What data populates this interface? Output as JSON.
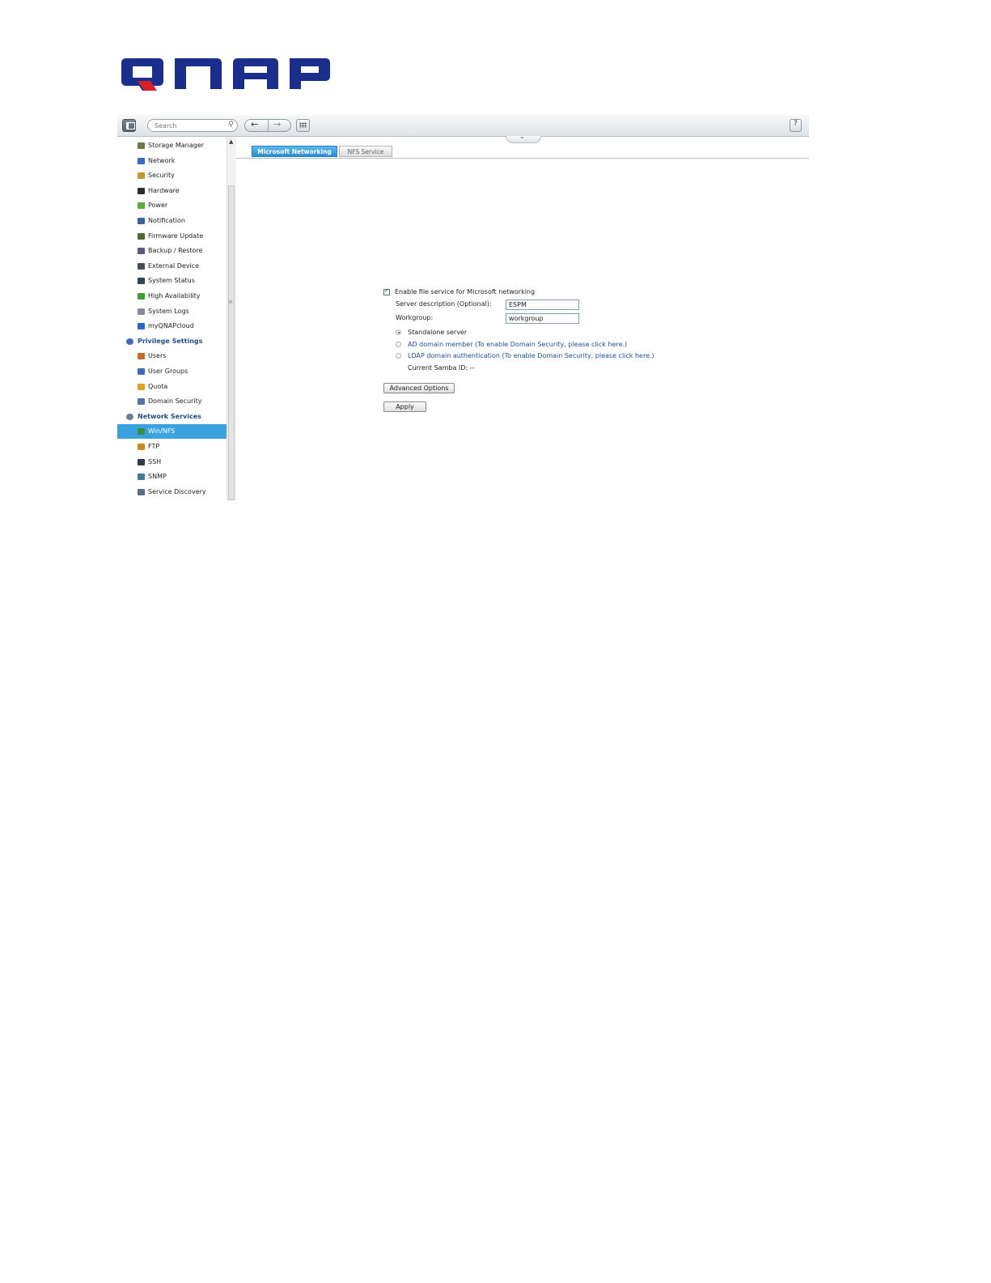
{
  "logo": {
    "text": "QNAP",
    "color": "#1a2e8e",
    "accent": "#d91f26"
  },
  "toolbar": {
    "search_placeholder": "Search",
    "search_icon": "magnifier-icon",
    "back_icon": "←",
    "forward_icon": "→",
    "help_label": "?"
  },
  "sidebar": {
    "items": [
      {
        "label": "Storage Manager",
        "icon": "storage-icon",
        "color": "#6b7b43"
      },
      {
        "label": "Network",
        "icon": "network-icon",
        "color": "#3b6ac0"
      },
      {
        "label": "Security",
        "icon": "lock-icon",
        "color": "#c49a2a"
      },
      {
        "label": "Hardware",
        "icon": "hardware-icon",
        "color": "#2d2d2d"
      },
      {
        "label": "Power",
        "icon": "power-bulb-icon",
        "color": "#5aae3b"
      },
      {
        "label": "Notification",
        "icon": "notification-icon",
        "color": "#3a63a8"
      },
      {
        "label": "Firmware Update",
        "icon": "firmware-icon",
        "color": "#4d6b2e"
      },
      {
        "label": "Backup / Restore",
        "icon": "backup-icon",
        "color": "#5b5b7b"
      },
      {
        "label": "External Device",
        "icon": "external-device-icon",
        "color": "#44505a"
      },
      {
        "label": "System Status",
        "icon": "monitor-icon",
        "color": "#2f4455"
      },
      {
        "label": "High Availability",
        "icon": "high-availability-icon",
        "color": "#3f9d3a"
      },
      {
        "label": "System Logs",
        "icon": "logs-icon",
        "color": "#8a8a9a"
      },
      {
        "label": "myQNAPcloud",
        "icon": "cloud-icon",
        "color": "#2a66c8"
      }
    ],
    "privilege_section": "Privilege Settings",
    "privilege_items": [
      {
        "label": "Users",
        "icon": "user-icon",
        "color": "#c9692a"
      },
      {
        "label": "User Groups",
        "icon": "user-groups-icon",
        "color": "#3b6ac0"
      },
      {
        "label": "Quota",
        "icon": "quota-icon",
        "color": "#e0a321"
      },
      {
        "label": "Domain Security",
        "icon": "domain-security-icon",
        "color": "#5574a8"
      }
    ],
    "network_section": "Network Services",
    "network_items": [
      {
        "label": "Win/NFS",
        "icon": "win-nfs-icon",
        "color": "#3b8f3a",
        "active": true
      },
      {
        "label": "FTP",
        "icon": "ftp-icon",
        "color": "#c98a1f"
      },
      {
        "label": "SSH",
        "icon": "ssh-icon",
        "color": "#2f3b45"
      },
      {
        "label": "SNMP",
        "icon": "snmp-icon",
        "color": "#3f7a9a"
      },
      {
        "label": "Service Discovery",
        "icon": "service-discovery-icon",
        "color": "#5a6c80"
      }
    ]
  },
  "tabs": [
    {
      "label": "Microsoft Networking",
      "active": true
    },
    {
      "label": "NFS Service",
      "active": false
    }
  ],
  "form": {
    "enable_label": "Enable file service for Microsoft networking",
    "enable_checked": true,
    "server_desc_label": "Server description (Optional):",
    "server_desc_value": "ESPM",
    "workgroup_label": "Workgroup:",
    "workgroup_value": "workgroup",
    "radio_standalone": "Standalone server",
    "radio_ad": "AD domain member (To enable Domain Security, please click here.)",
    "radio_ldap": "LDAP domain authentication (To enable Domain Security, please click here.)",
    "samba_id_label": "Current Samba ID: --",
    "advanced_button": "Advanced Options",
    "apply_button": "Apply"
  }
}
